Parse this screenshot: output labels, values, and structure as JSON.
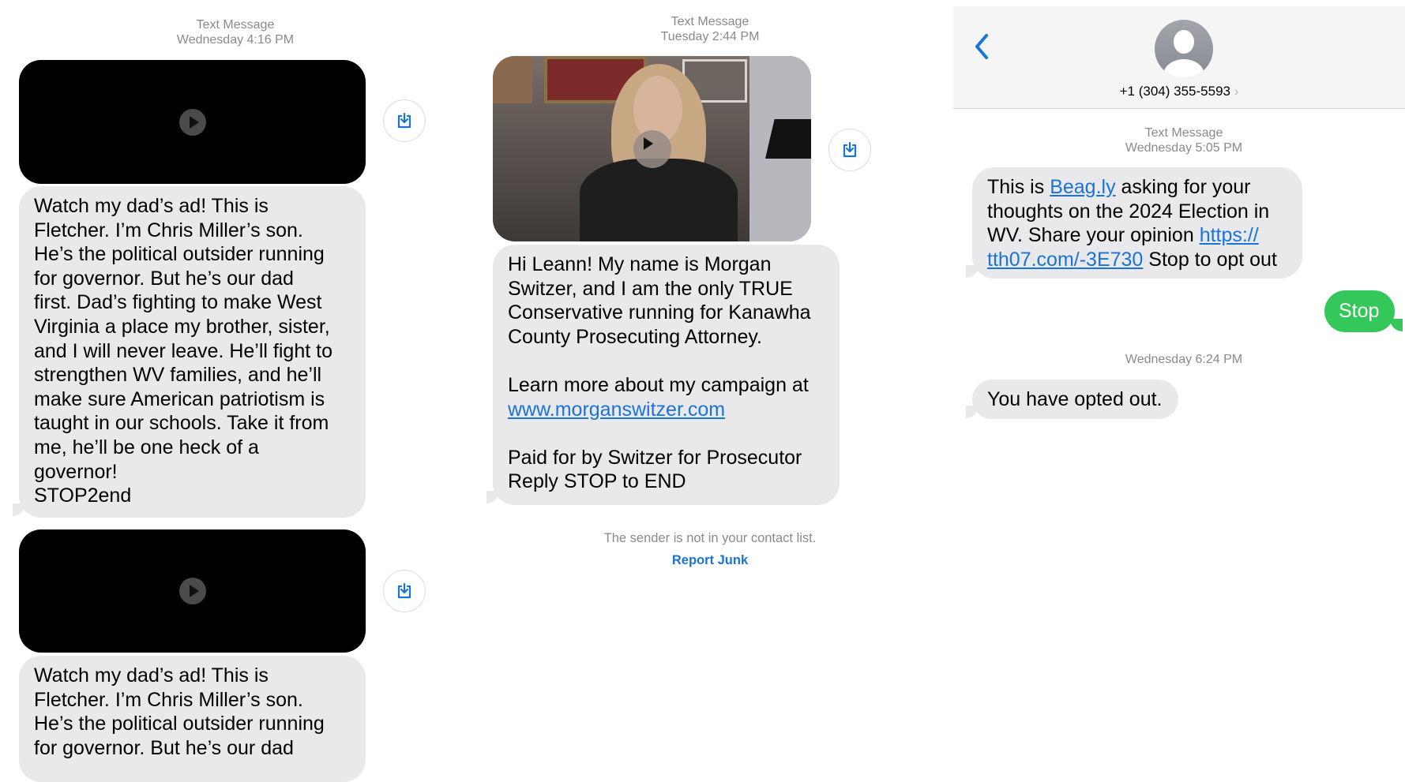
{
  "col1": {
    "header_type": "Text Message",
    "header_time": "Wednesday 4:16 PM",
    "messages": [
      "Watch my dad’s ad! This is\nFletcher. I’m Chris Miller’s son.\nHe’s the political outsider running\nfor governor. But he’s our dad\nfirst. Dad’s fighting to make West\nVirginia a place my brother, sister,\nand I will never leave. He’ll fight to\nstrengthen WV families, and he’ll\nmake sure American patriotism is\ntaught in our schools. Take it from\nme, he’ll be one heck of a\ngovernor!\nSTOP2end",
      "Watch my dad’s ad! This is\nFletcher. I’m Chris Miller’s son.\nHe’s the political outsider running\nfor governor. But he’s our dad"
    ]
  },
  "col2": {
    "header_type": "Text Message",
    "header_time": "Tuesday 2:44 PM",
    "msg_part1": "Hi Leann! My name is Morgan\nSwitzer, and I am the only TRUE\nConservative running for Kanawha\nCounty Prosecuting Attorney.\n\nLearn more about my campaign at",
    "msg_link": "www.morganswitzer.com",
    "msg_part2": "Paid for by Switzer for Prosecutor\nReply STOP to END",
    "notice": "The sender is not in your contact list.",
    "report_junk": "Report Junk"
  },
  "col3": {
    "contact": "+1 (304) 355-5593",
    "header_type": "Text Message",
    "header_time": "Wednesday 5:05 PM",
    "msg": {
      "t1": "This is ",
      "link1": "Beag.ly",
      "t2": " asking for your\nthoughts on the 2024 Election in\nWV. Share your opinion ",
      "link2a": "https://",
      "link2b": "tth07.com/-3E730",
      "t3": " Stop to opt out"
    },
    "sent": "Stop",
    "time2": "Wednesday 6:24 PM",
    "reply": "You have opted out."
  },
  "colors": {
    "bubble_gray": "#e9e9eb",
    "sent_green": "#34c759",
    "link_blue": "#1a73d9"
  }
}
